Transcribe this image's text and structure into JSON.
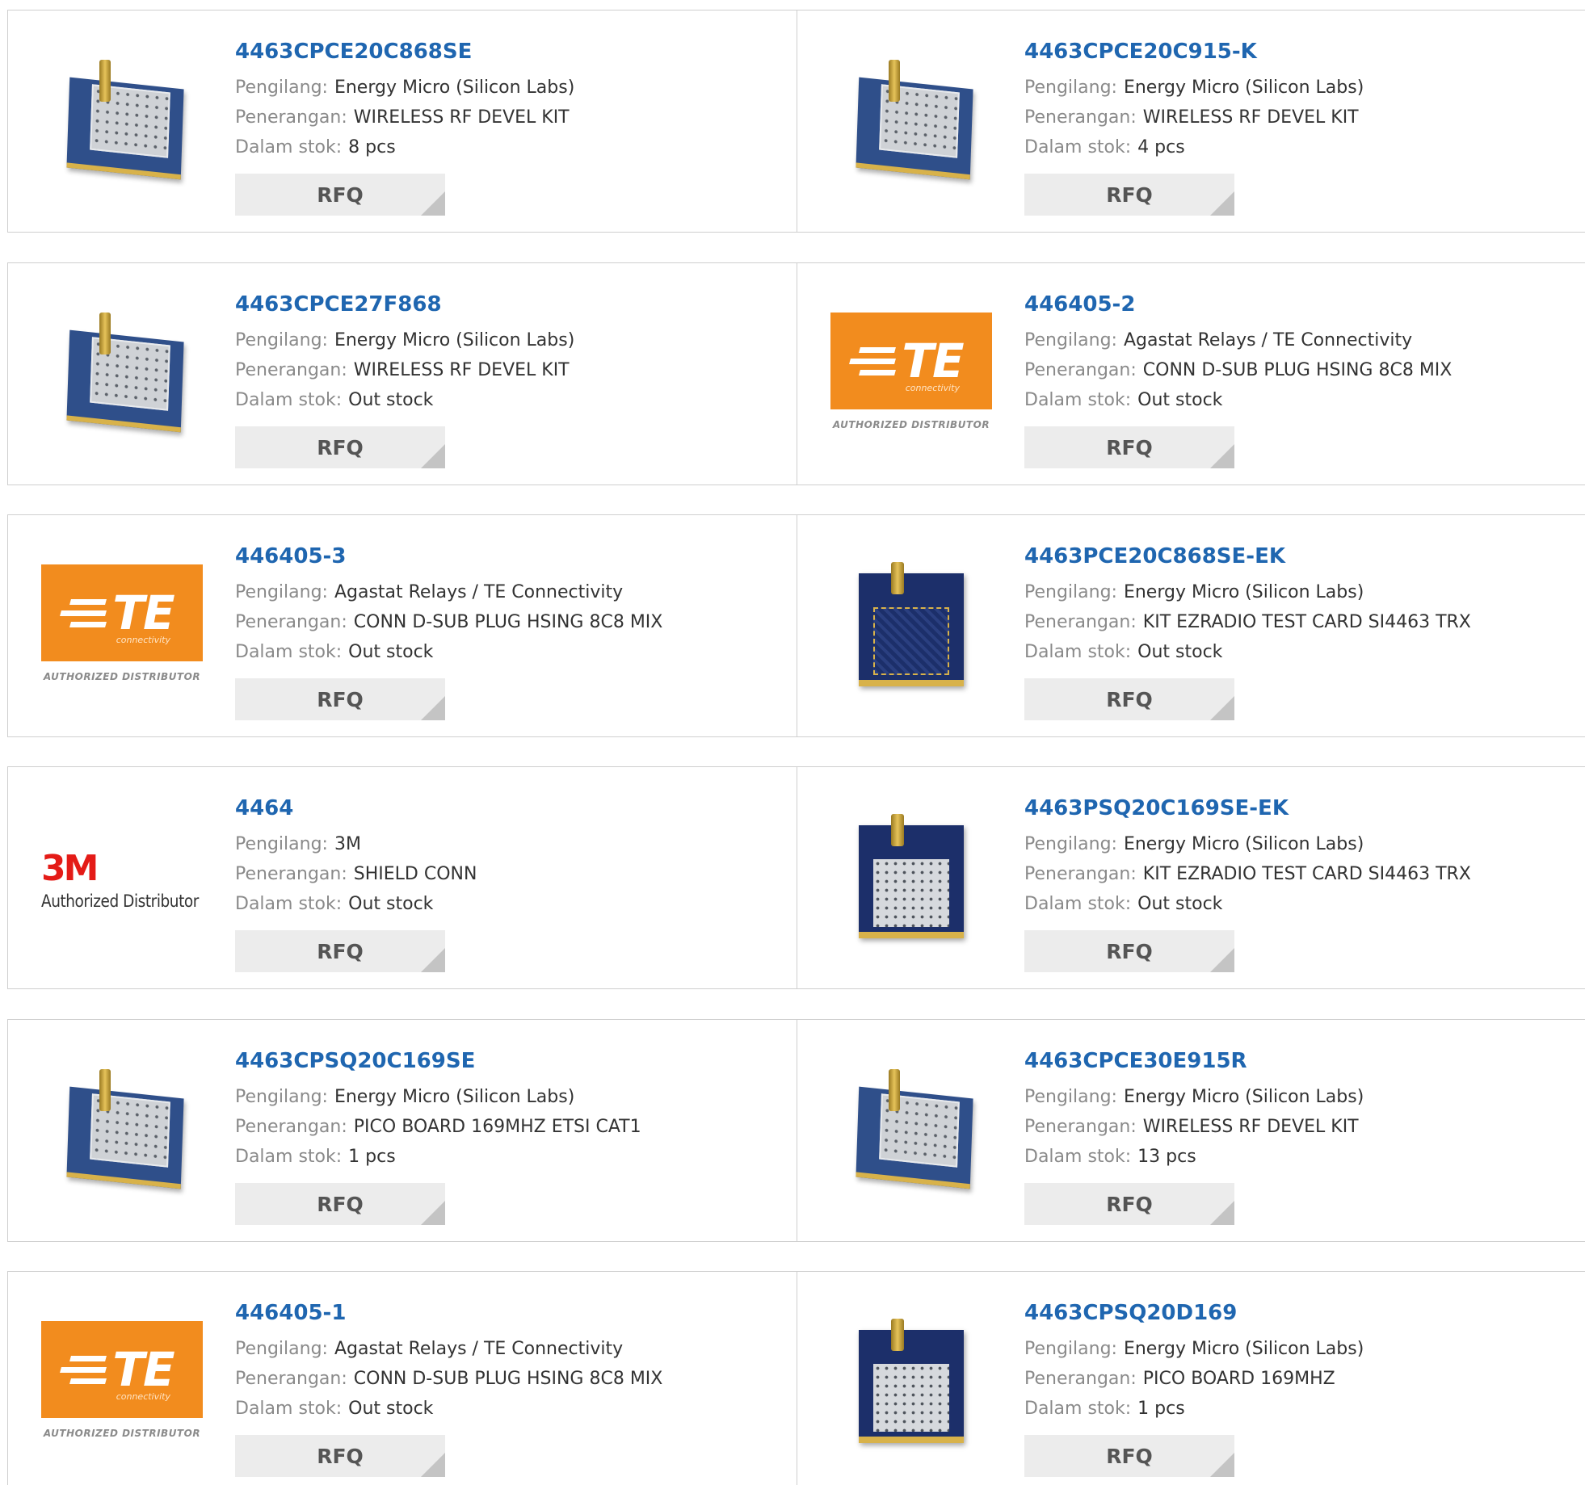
{
  "labels": {
    "manufacturer": "Pengilang:",
    "description": "Penerangan:",
    "stock": "Dalam stok:",
    "rfq": "RFQ"
  },
  "logos": {
    "te_text": "TE",
    "te_sub": "connectivity",
    "te_authorized": "AUTHORIZED DISTRIBUTOR",
    "mmm_text": "3M",
    "mmm_authorized": "Authorized Distributor"
  },
  "colors": {
    "link": "#1f66b0",
    "te_orange": "#f28c1e",
    "mmm_red": "#e41b17",
    "button_bg": "#ececec"
  },
  "products": [
    {
      "part": "4463CPCE20C868SE",
      "manufacturer": "Energy Micro (Silicon Labs)",
      "description": "WIRELESS RF DEVEL KIT",
      "stock": "8 pcs",
      "image": "board-diagonal"
    },
    {
      "part": "4463CPCE20C915-K",
      "manufacturer": "Energy Micro (Silicon Labs)",
      "description": "WIRELESS RF DEVEL KIT",
      "stock": "4 pcs",
      "image": "board-diagonal"
    },
    {
      "part": "4463CPCE27F868",
      "manufacturer": "Energy Micro (Silicon Labs)",
      "description": "WIRELESS RF DEVEL KIT",
      "stock": "Out stock",
      "image": "board-diagonal"
    },
    {
      "part": "446405-2",
      "manufacturer": "Agastat Relays / TE Connectivity",
      "description": "CONN D-SUB PLUG HSING 8C8 MIX",
      "stock": "Out stock",
      "image": "te-logo"
    },
    {
      "part": "446405-3",
      "manufacturer": "Agastat Relays / TE Connectivity",
      "description": "CONN D-SUB PLUG HSING 8C8 MIX",
      "stock": "Out stock",
      "image": "te-logo"
    },
    {
      "part": "4463PCE20C868SE-EK",
      "manufacturer": "Energy Micro (Silicon Labs)",
      "description": "KIT EZRADIO TEST CARD SI4463 TRX",
      "stock": "Out stock",
      "image": "board-traces"
    },
    {
      "part": "4464",
      "manufacturer": "3M",
      "description": "SHIELD CONN",
      "stock": "Out stock",
      "image": "3m-logo"
    },
    {
      "part": "4463PSQ20C169SE-EK",
      "manufacturer": "Energy Micro (Silicon Labs)",
      "description": "KIT EZRADIO TEST CARD SI4463 TRX",
      "stock": "Out stock",
      "image": "board-flat"
    },
    {
      "part": "4463CPSQ20C169SE",
      "manufacturer": "Energy Micro (Silicon Labs)",
      "description": "PICO BOARD 169MHZ ETSI CAT1",
      "stock": "1 pcs",
      "image": "board-diagonal"
    },
    {
      "part": "4463CPCE30E915R",
      "manufacturer": "Energy Micro (Silicon Labs)",
      "description": "WIRELESS RF DEVEL KIT",
      "stock": "13 pcs",
      "image": "board-diagonal"
    },
    {
      "part": "446405-1",
      "manufacturer": "Agastat Relays / TE Connectivity",
      "description": "CONN D-SUB PLUG HSING 8C8 MIX",
      "stock": "Out stock",
      "image": "te-logo"
    },
    {
      "part": "4463CPSQ20D169",
      "manufacturer": "Energy Micro (Silicon Labs)",
      "description": "PICO BOARD 169MHZ",
      "stock": "1 pcs",
      "image": "board-flat"
    }
  ]
}
